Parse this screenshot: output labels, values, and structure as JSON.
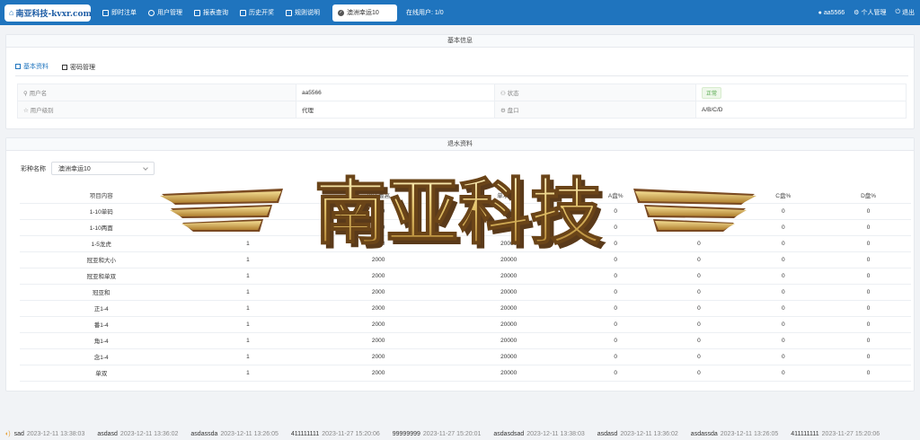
{
  "header": {
    "brand": "南亚科技-kvxr.com",
    "nav": [
      {
        "label": "即时注单",
        "icon": "grid-icon"
      },
      {
        "label": "用户管理",
        "icon": "user-icon"
      },
      {
        "label": "报表查询",
        "icon": "table-icon"
      },
      {
        "label": "历史开奖",
        "icon": "monitor-icon"
      },
      {
        "label": "规则说明",
        "icon": "book-icon"
      }
    ],
    "lottery": "澳洲幸运10",
    "online": "在线用户: 1/0",
    "right": [
      {
        "label": "aa5566",
        "icon": "user-icon"
      },
      {
        "label": "个人管理",
        "icon": "gear-icon"
      },
      {
        "label": "退出",
        "icon": "power-icon"
      }
    ]
  },
  "basic": {
    "title": "基本信息",
    "tabs": [
      "基本资料",
      "密码管理"
    ],
    "rows": [
      {
        "label": "用户名",
        "value": "aa5566",
        "label2": "状态",
        "value2": "正常"
      },
      {
        "label": "用户级别",
        "value": "代理",
        "label2": "盘口",
        "value2": "A/B/C/D"
      }
    ]
  },
  "rebate": {
    "title": "退水资料",
    "select_label": "彩种名称",
    "select_value": "澳洲幸运10",
    "columns": [
      "项目内容",
      "单注最低",
      "单注最高",
      "单项最高",
      "A盘%",
      "B盘%",
      "C盘%",
      "D盘%"
    ],
    "rows": [
      [
        "1-10单码",
        "1",
        "2000",
        "20000",
        "0",
        "0",
        "0",
        "0"
      ],
      [
        "1-10两面",
        "1",
        "2000",
        "20000",
        "0",
        "0",
        "0",
        "0"
      ],
      [
        "1-5龙虎",
        "1",
        "2000",
        "20000",
        "0",
        "0",
        "0",
        "0"
      ],
      [
        "冠亚和大小",
        "1",
        "2000",
        "20000",
        "0",
        "0",
        "0",
        "0"
      ],
      [
        "冠亚和单双",
        "1",
        "2000",
        "20000",
        "0",
        "0",
        "0",
        "0"
      ],
      [
        "冠亚和",
        "1",
        "2000",
        "20000",
        "0",
        "0",
        "0",
        "0"
      ],
      [
        "正1-4",
        "1",
        "2000",
        "20000",
        "0",
        "0",
        "0",
        "0"
      ],
      [
        "番1-4",
        "1",
        "2000",
        "20000",
        "0",
        "0",
        "0",
        "0"
      ],
      [
        "角1-4",
        "1",
        "2000",
        "20000",
        "0",
        "0",
        "0",
        "0"
      ],
      [
        "念1-4",
        "1",
        "2000",
        "20000",
        "0",
        "0",
        "0",
        "0"
      ],
      [
        "单双",
        "1",
        "2000",
        "20000",
        "0",
        "0",
        "0",
        "0"
      ]
    ]
  },
  "watermark": "南亚科技",
  "ticker": [
    {
      "msg": "sad",
      "time": "2023-12-11 13:38:03"
    },
    {
      "msg": "asdasd",
      "time": "2023-12-11 13:36:02"
    },
    {
      "msg": "asdassda",
      "time": "2023-12-11 13:26:05"
    },
    {
      "msg": "411111111",
      "time": "2023-11-27 15:20:06"
    },
    {
      "msg": "99999999",
      "time": "2023-11-27 15:20:01"
    },
    {
      "msg": "asdasdsad",
      "time": "2023-12-11 13:38:03"
    },
    {
      "msg": "asdasd",
      "time": "2023-12-11 13:36:02"
    },
    {
      "msg": "asdassda",
      "time": "2023-12-11 13:26:05"
    },
    {
      "msg": "411111111",
      "time": "2023-11-27 15:20:06"
    }
  ],
  "colors": {
    "primary": "#1f74be",
    "status_ok": "#53a84c"
  }
}
